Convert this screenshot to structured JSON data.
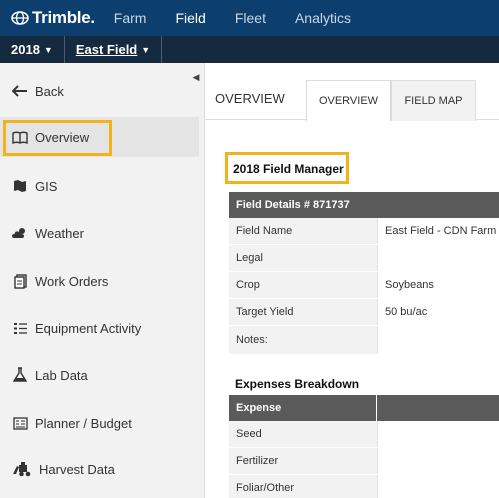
{
  "brand": {
    "name": "Trimble."
  },
  "topnav": {
    "items": [
      "Farm",
      "Field",
      "Fleet",
      "Analytics"
    ],
    "active": "Field"
  },
  "subbar": {
    "year": "2018",
    "field": "East Field"
  },
  "sidebar": {
    "items": [
      {
        "label": "Back",
        "icon": "back-arrow-icon"
      },
      {
        "label": "Overview",
        "icon": "book-icon"
      },
      {
        "label": "GIS",
        "icon": "map-icon"
      },
      {
        "label": "Weather",
        "icon": "weather-icon"
      },
      {
        "label": "Work Orders",
        "icon": "clipboard-icon"
      },
      {
        "label": "Equipment Activity",
        "icon": "list-icon"
      },
      {
        "label": "Lab Data",
        "icon": "flask-icon"
      },
      {
        "label": "Planner / Budget",
        "icon": "planner-icon"
      },
      {
        "label": "Harvest Data",
        "icon": "harvester-icon"
      }
    ]
  },
  "main": {
    "heading": "OVERVIEW",
    "tabs": [
      "OVERVIEW",
      "FIELD MAP"
    ],
    "title": "2018 Field Manager",
    "details": {
      "header": "Field Details # 871737",
      "rows": [
        {
          "k": "Field Name",
          "v": "East Field - CDN Farm"
        },
        {
          "k": "Legal",
          "v": ""
        },
        {
          "k": "Crop",
          "v": "Soybeans"
        },
        {
          "k": "Target Yield",
          "v": "50 bu/ac"
        },
        {
          "k": "Notes:",
          "v": ""
        }
      ]
    },
    "expenses": {
      "title": "Expenses Breakdown",
      "header": "Expense",
      "rows": [
        "Seed",
        "Fertilizer",
        "Foliar/Other"
      ]
    }
  },
  "colors": {
    "nav": "#0d3f6e",
    "subbar": "#152a3f",
    "highlight": "#f2b21c",
    "table_header": "#5a5a5a"
  }
}
